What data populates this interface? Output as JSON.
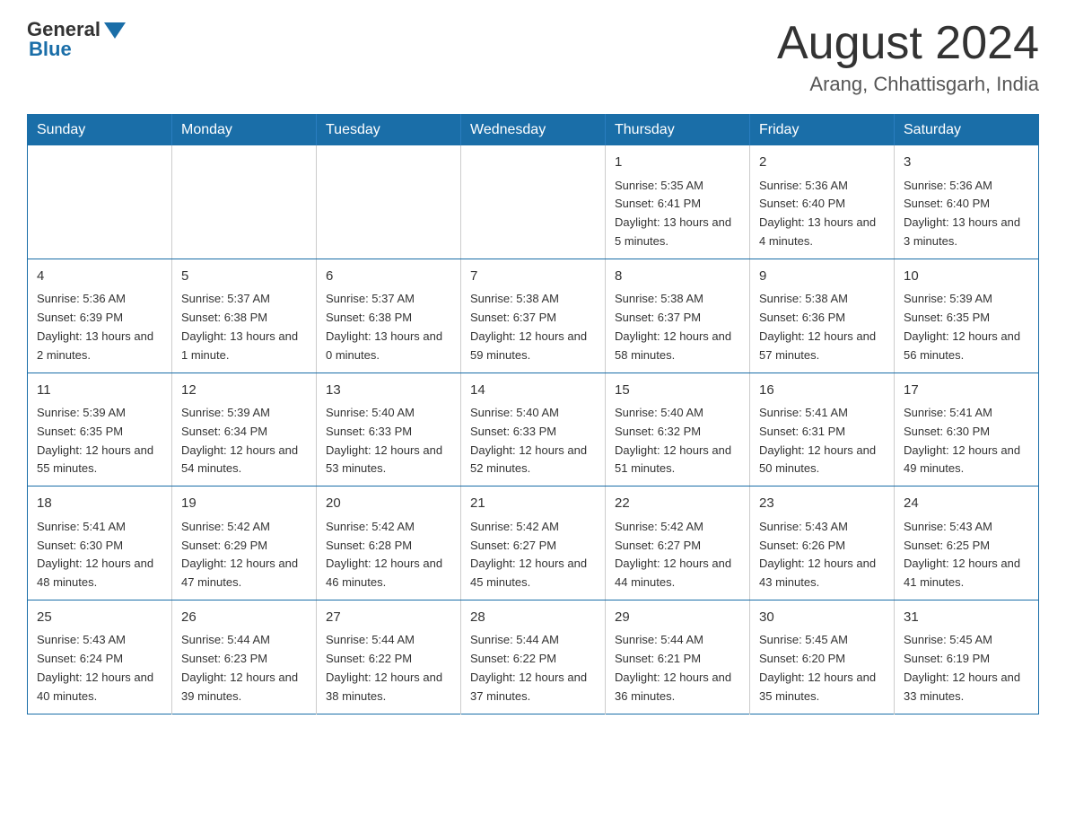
{
  "logo": {
    "general": "General",
    "blue": "Blue"
  },
  "header": {
    "month": "August 2024",
    "location": "Arang, Chhattisgarh, India"
  },
  "days_of_week": [
    "Sunday",
    "Monday",
    "Tuesday",
    "Wednesday",
    "Thursday",
    "Friday",
    "Saturday"
  ],
  "weeks": [
    [
      {
        "day": "",
        "info": ""
      },
      {
        "day": "",
        "info": ""
      },
      {
        "day": "",
        "info": ""
      },
      {
        "day": "",
        "info": ""
      },
      {
        "day": "1",
        "info": "Sunrise: 5:35 AM\nSunset: 6:41 PM\nDaylight: 13 hours and 5 minutes."
      },
      {
        "day": "2",
        "info": "Sunrise: 5:36 AM\nSunset: 6:40 PM\nDaylight: 13 hours and 4 minutes."
      },
      {
        "day": "3",
        "info": "Sunrise: 5:36 AM\nSunset: 6:40 PM\nDaylight: 13 hours and 3 minutes."
      }
    ],
    [
      {
        "day": "4",
        "info": "Sunrise: 5:36 AM\nSunset: 6:39 PM\nDaylight: 13 hours and 2 minutes."
      },
      {
        "day": "5",
        "info": "Sunrise: 5:37 AM\nSunset: 6:38 PM\nDaylight: 13 hours and 1 minute."
      },
      {
        "day": "6",
        "info": "Sunrise: 5:37 AM\nSunset: 6:38 PM\nDaylight: 13 hours and 0 minutes."
      },
      {
        "day": "7",
        "info": "Sunrise: 5:38 AM\nSunset: 6:37 PM\nDaylight: 12 hours and 59 minutes."
      },
      {
        "day": "8",
        "info": "Sunrise: 5:38 AM\nSunset: 6:37 PM\nDaylight: 12 hours and 58 minutes."
      },
      {
        "day": "9",
        "info": "Sunrise: 5:38 AM\nSunset: 6:36 PM\nDaylight: 12 hours and 57 minutes."
      },
      {
        "day": "10",
        "info": "Sunrise: 5:39 AM\nSunset: 6:35 PM\nDaylight: 12 hours and 56 minutes."
      }
    ],
    [
      {
        "day": "11",
        "info": "Sunrise: 5:39 AM\nSunset: 6:35 PM\nDaylight: 12 hours and 55 minutes."
      },
      {
        "day": "12",
        "info": "Sunrise: 5:39 AM\nSunset: 6:34 PM\nDaylight: 12 hours and 54 minutes."
      },
      {
        "day": "13",
        "info": "Sunrise: 5:40 AM\nSunset: 6:33 PM\nDaylight: 12 hours and 53 minutes."
      },
      {
        "day": "14",
        "info": "Sunrise: 5:40 AM\nSunset: 6:33 PM\nDaylight: 12 hours and 52 minutes."
      },
      {
        "day": "15",
        "info": "Sunrise: 5:40 AM\nSunset: 6:32 PM\nDaylight: 12 hours and 51 minutes."
      },
      {
        "day": "16",
        "info": "Sunrise: 5:41 AM\nSunset: 6:31 PM\nDaylight: 12 hours and 50 minutes."
      },
      {
        "day": "17",
        "info": "Sunrise: 5:41 AM\nSunset: 6:30 PM\nDaylight: 12 hours and 49 minutes."
      }
    ],
    [
      {
        "day": "18",
        "info": "Sunrise: 5:41 AM\nSunset: 6:30 PM\nDaylight: 12 hours and 48 minutes."
      },
      {
        "day": "19",
        "info": "Sunrise: 5:42 AM\nSunset: 6:29 PM\nDaylight: 12 hours and 47 minutes."
      },
      {
        "day": "20",
        "info": "Sunrise: 5:42 AM\nSunset: 6:28 PM\nDaylight: 12 hours and 46 minutes."
      },
      {
        "day": "21",
        "info": "Sunrise: 5:42 AM\nSunset: 6:27 PM\nDaylight: 12 hours and 45 minutes."
      },
      {
        "day": "22",
        "info": "Sunrise: 5:42 AM\nSunset: 6:27 PM\nDaylight: 12 hours and 44 minutes."
      },
      {
        "day": "23",
        "info": "Sunrise: 5:43 AM\nSunset: 6:26 PM\nDaylight: 12 hours and 43 minutes."
      },
      {
        "day": "24",
        "info": "Sunrise: 5:43 AM\nSunset: 6:25 PM\nDaylight: 12 hours and 41 minutes."
      }
    ],
    [
      {
        "day": "25",
        "info": "Sunrise: 5:43 AM\nSunset: 6:24 PM\nDaylight: 12 hours and 40 minutes."
      },
      {
        "day": "26",
        "info": "Sunrise: 5:44 AM\nSunset: 6:23 PM\nDaylight: 12 hours and 39 minutes."
      },
      {
        "day": "27",
        "info": "Sunrise: 5:44 AM\nSunset: 6:22 PM\nDaylight: 12 hours and 38 minutes."
      },
      {
        "day": "28",
        "info": "Sunrise: 5:44 AM\nSunset: 6:22 PM\nDaylight: 12 hours and 37 minutes."
      },
      {
        "day": "29",
        "info": "Sunrise: 5:44 AM\nSunset: 6:21 PM\nDaylight: 12 hours and 36 minutes."
      },
      {
        "day": "30",
        "info": "Sunrise: 5:45 AM\nSunset: 6:20 PM\nDaylight: 12 hours and 35 minutes."
      },
      {
        "day": "31",
        "info": "Sunrise: 5:45 AM\nSunset: 6:19 PM\nDaylight: 12 hours and 33 minutes."
      }
    ]
  ]
}
